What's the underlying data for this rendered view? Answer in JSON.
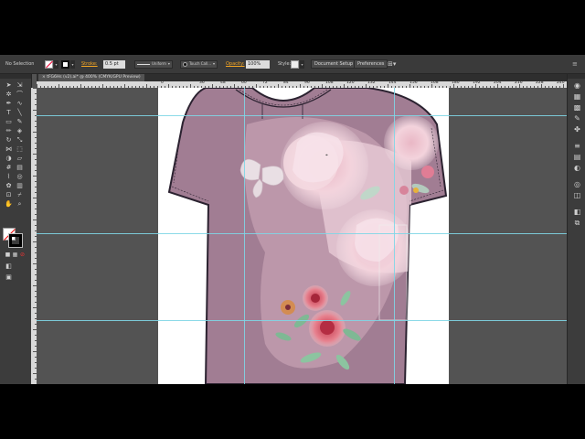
{
  "control_bar": {
    "selection_label": "No Selection",
    "stroke_label": "Stroke:",
    "stroke_weight": "0.5 pt",
    "profile_label": "Uniform",
    "brush_label": "Touch Call...",
    "opacity_label": "Opacity:",
    "opacity_value": "100%",
    "style_label": "Style:",
    "document_setup_label": "Document Setup",
    "preferences_label": "Preferences"
  },
  "document": {
    "tab_title": "tFG6Hs (v2).ai* @ 400% (CMYK/GPU Preview)"
  },
  "ruler": {
    "labels": [
      "0",
      "36",
      "48",
      "60",
      "72",
      "84",
      "96",
      "108",
      "120",
      "132",
      "144",
      "156",
      "168",
      "180",
      "192",
      "204",
      "216",
      "228",
      "240"
    ]
  },
  "colors": {
    "ui_dark": "#3a3a3a",
    "pasteboard": "#535353",
    "guide": "#7fd6e6",
    "garment_mauve": "#a17d93",
    "garment_outline": "#2b2230",
    "accent_orange": "#f5a623"
  },
  "tools": {
    "icons": [
      "selection-tool",
      "direct-selection-tool",
      "magic-wand-tool",
      "lasso-tool",
      "pen-tool",
      "curvature-tool",
      "type-tool",
      "line-tool",
      "rectangle-tool",
      "paintbrush-tool",
      "pencil-tool",
      "eraser-tool",
      "rotate-tool",
      "scale-tool",
      "width-tool",
      "free-transform-tool",
      "shape-builder-tool",
      "perspective-tool",
      "mesh-tool",
      "gradient-tool",
      "eyedropper-tool",
      "blend-tool",
      "symbol-sprayer-tool",
      "graph-tool",
      "artboard-tool",
      "slice-tool",
      "hand-tool",
      "zoom-tool"
    ]
  },
  "right_panel": {
    "icons": [
      "color-icon",
      "color-guide-icon",
      "swatches-icon",
      "brushes-icon",
      "symbols-icon",
      "stroke-icon",
      "gradient-icon",
      "transparency-icon",
      "appearance-icon",
      "graphic-styles-icon",
      "layers-icon",
      "artboards-icon"
    ]
  }
}
